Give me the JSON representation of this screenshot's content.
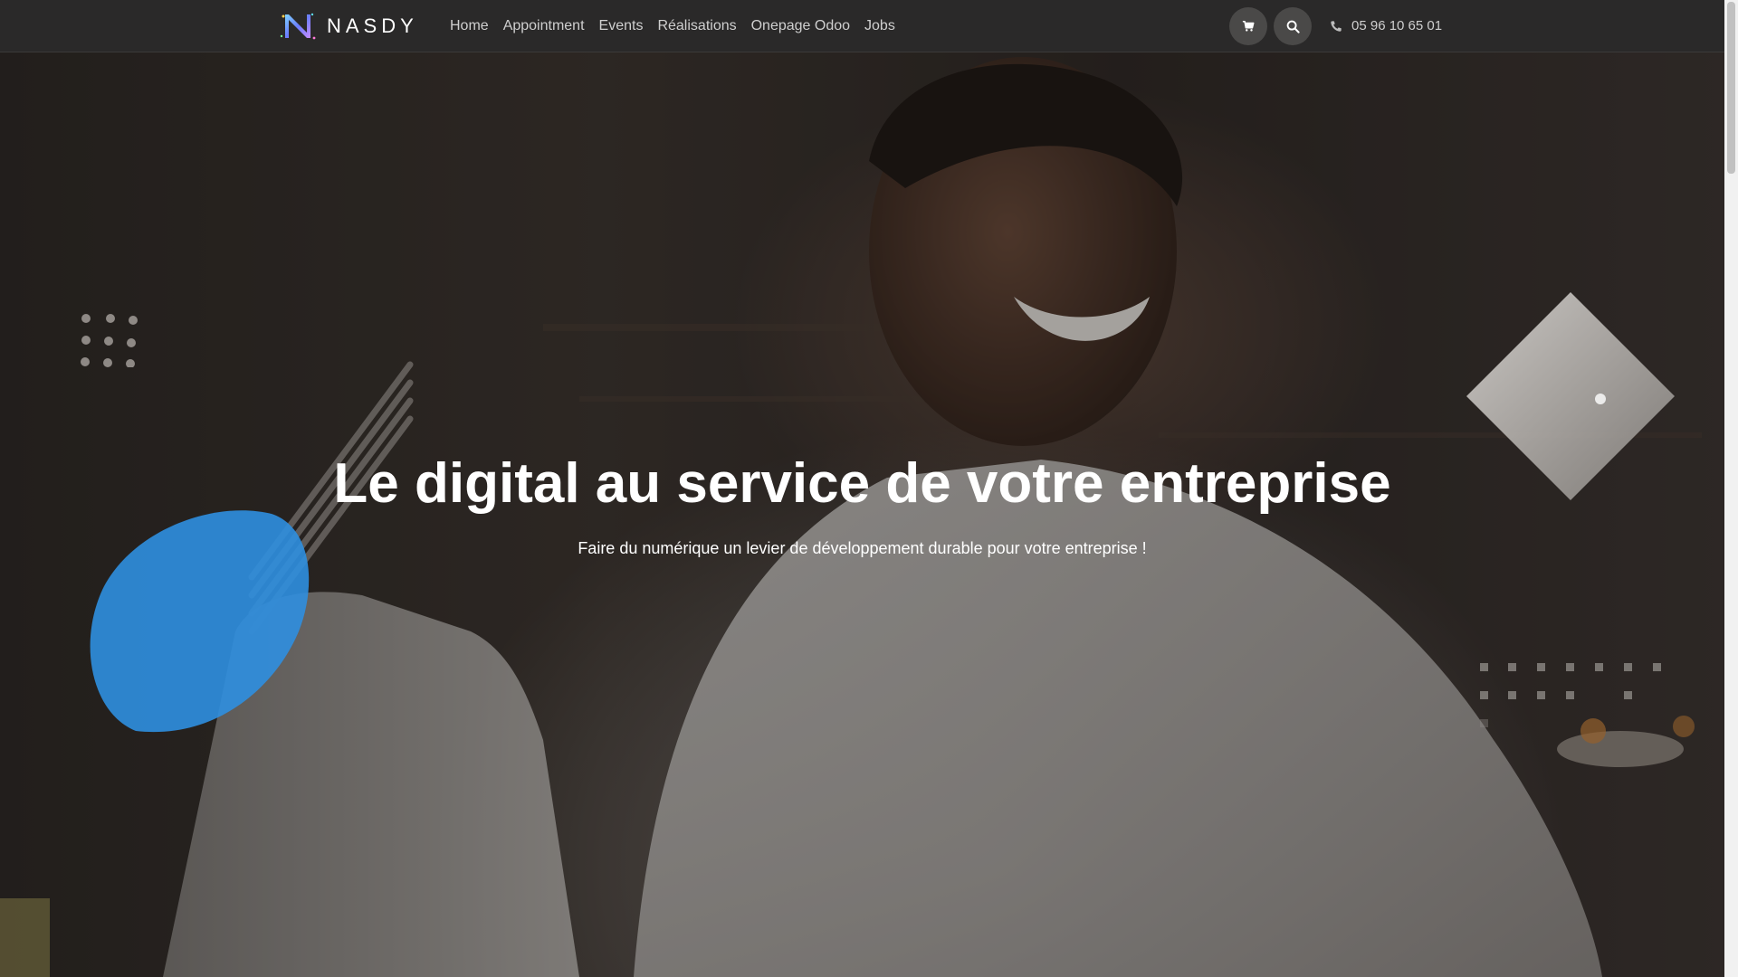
{
  "brand": {
    "name": "NASDY",
    "logo_icon": "nasdy-n-logo"
  },
  "nav": {
    "items": [
      {
        "label": "Home"
      },
      {
        "label": "Appointment"
      },
      {
        "label": "Events"
      },
      {
        "label": "Réalisations"
      },
      {
        "label": "Onepage Odoo"
      },
      {
        "label": "Jobs"
      }
    ],
    "cart_icon": "shopping-cart-icon",
    "search_icon": "search-icon",
    "phone_icon": "phone-icon",
    "phone": "05 96 10 65 01"
  },
  "hero": {
    "title": "Le digital au service de votre entreprise",
    "subtitle": "Faire du numérique un levier de développement durable pour votre entreprise !"
  },
  "colors": {
    "navbar": "#2a2929",
    "nav_text": "#cfcfcf",
    "accent_blue": "#2f8fe0",
    "hero_text": "#ffffff"
  }
}
